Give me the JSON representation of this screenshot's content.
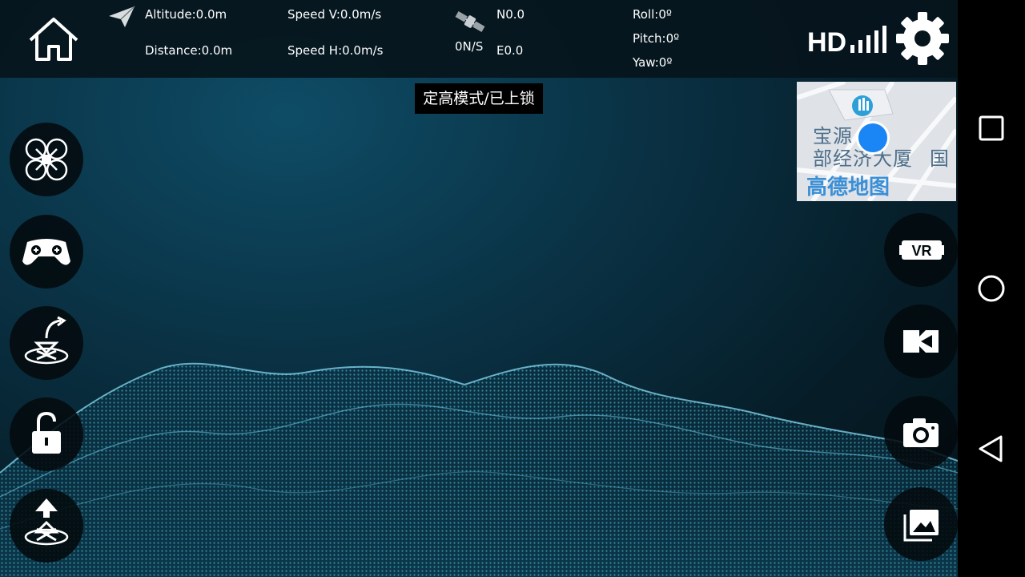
{
  "telemetry": {
    "altitude": "Altitude:0.0m",
    "distance": "Distance:0.0m",
    "speed_v": "Speed V:0.0m/s",
    "speed_h": "Speed H:0.0m/s",
    "satellites": "0N/S",
    "north": "N0.0",
    "east": "E0.0",
    "roll": "Roll:0º",
    "pitch": "Pitch:0º",
    "yaw": "Yaw:0º"
  },
  "signal": {
    "label": "HD",
    "bars": 5
  },
  "mode_banner": "定高模式/已上锁",
  "map": {
    "poi_line1": "宝源    总",
    "poi_line2": "部经济大厦",
    "poi_line3": "国",
    "provider": "高德地图",
    "location_color": "#1a86f5"
  },
  "left_controls": [
    "drone-mode",
    "gamepad",
    "one-key-takeoff",
    "lock",
    "one-key-landing"
  ],
  "right_controls": [
    "vr-mode",
    "video-record",
    "camera-capture",
    "gallery"
  ],
  "icons": {
    "right": {
      "vr": "VR"
    }
  },
  "colors": {
    "accent_wave": "#5fd0ee",
    "topbar_bg": "#06141c",
    "button_bg": "#030a0e"
  }
}
